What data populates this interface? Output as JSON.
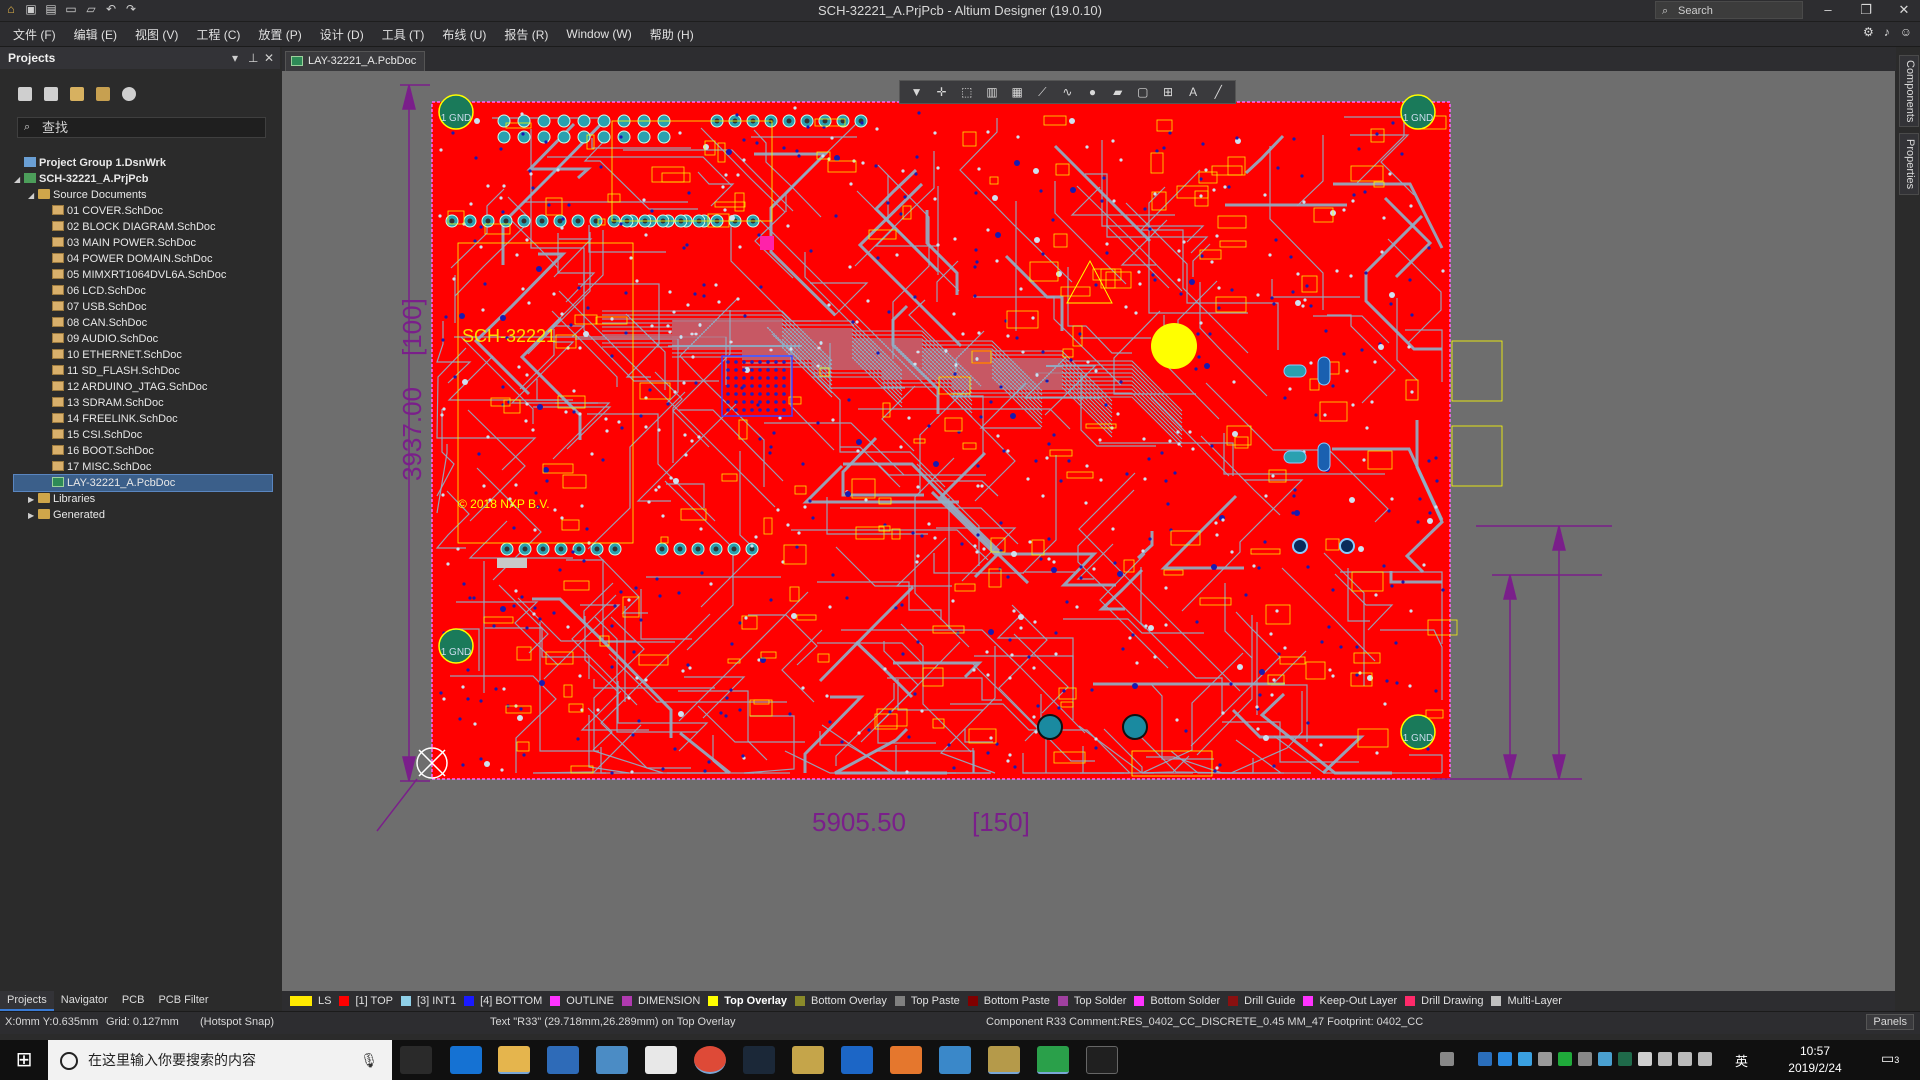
{
  "window": {
    "title": "SCH-32221_A.PrjPcb - Altium Designer (19.0.10)",
    "search_placeholder": "Search",
    "minimize": "–",
    "restore": "❐",
    "close": "✕"
  },
  "menu": [
    "文件 (F)",
    "编辑 (E)",
    "视图 (V)",
    "工程 (C)",
    "放置 (P)",
    "设计 (D)",
    "工具 (T)",
    "布线 (U)",
    "报告 (R)",
    "Window (W)",
    "帮助 (H)"
  ],
  "projects_panel": {
    "title": "Projects",
    "search_placeholder": "查找",
    "tree": [
      {
        "label": "Project Group 1.DsnWrk",
        "level": 0,
        "icon": "group",
        "bold": true,
        "arrow": ""
      },
      {
        "label": "SCH-32221_A.PrjPcb",
        "level": 0,
        "icon": "project",
        "bold": true,
        "arrow": "◢"
      },
      {
        "label": "Source Documents",
        "level": 1,
        "icon": "folder",
        "bold": false,
        "arrow": "◢"
      },
      {
        "label": "01 COVER.SchDoc",
        "level": 2,
        "icon": "doc"
      },
      {
        "label": "02 BLOCK DIAGRAM.SchDoc",
        "level": 2,
        "icon": "doc"
      },
      {
        "label": "03 MAIN POWER.SchDoc",
        "level": 2,
        "icon": "doc"
      },
      {
        "label": "04 POWER DOMAIN.SchDoc",
        "level": 2,
        "icon": "doc"
      },
      {
        "label": "05 MIMXRT1064DVL6A.SchDoc",
        "level": 2,
        "icon": "doc"
      },
      {
        "label": "06 LCD.SchDoc",
        "level": 2,
        "icon": "doc"
      },
      {
        "label": "07 USB.SchDoc",
        "level": 2,
        "icon": "doc"
      },
      {
        "label": "08 CAN.SchDoc",
        "level": 2,
        "icon": "doc"
      },
      {
        "label": "09 AUDIO.SchDoc",
        "level": 2,
        "icon": "doc"
      },
      {
        "label": "10 ETHERNET.SchDoc",
        "level": 2,
        "icon": "doc"
      },
      {
        "label": "11 SD_FLASH.SchDoc",
        "level": 2,
        "icon": "doc"
      },
      {
        "label": "12 ARDUINO_JTAG.SchDoc",
        "level": 2,
        "icon": "doc"
      },
      {
        "label": "13 SDRAM.SchDoc",
        "level": 2,
        "icon": "doc"
      },
      {
        "label": "14 FREELINK.SchDoc",
        "level": 2,
        "icon": "doc"
      },
      {
        "label": "15 CSI.SchDoc",
        "level": 2,
        "icon": "doc"
      },
      {
        "label": "16 BOOT.SchDoc",
        "level": 2,
        "icon": "doc"
      },
      {
        "label": "17 MISC.SchDoc",
        "level": 2,
        "icon": "doc"
      },
      {
        "label": "LAY-32221_A.PcbDoc",
        "level": 2,
        "icon": "pcb",
        "selected": true
      },
      {
        "label": "Libraries",
        "level": 1,
        "icon": "folder",
        "arrow": "▶"
      },
      {
        "label": "Generated",
        "level": 1,
        "icon": "folder",
        "arrow": "▶"
      }
    ],
    "tabs": [
      "Projects",
      "Navigator",
      "PCB",
      "PCB Filter"
    ]
  },
  "document_tab": "LAY-32221_A.PcbDoc",
  "right_tabs": [
    "Components",
    "Properties"
  ],
  "board": {
    "silk_texts": [
      "SCH-32221",
      "© 2018 NXP B.V.",
      "1 GND",
      "3937.00",
      "[100]",
      "5905.50",
      "[150]"
    ],
    "colors": {
      "board": "#ff0000",
      "track": "#8fb0c8",
      "overlay": "#ffff00",
      "dimension": "#7a1f8a",
      "canvas": "#6e6e6e"
    }
  },
  "layers": [
    {
      "name": "LS",
      "color": "#ffea00"
    },
    {
      "name": "[1] TOP",
      "color": "#ff0000"
    },
    {
      "name": "[3] INT1",
      "color": "#8fd0e8"
    },
    {
      "name": "[4] BOTTOM",
      "color": "#1a1aff"
    },
    {
      "name": "OUTLINE",
      "color": "#ff33ff"
    },
    {
      "name": "DIMENSION",
      "color": "#b03ab0"
    },
    {
      "name": "Top Overlay",
      "color": "#ffff00",
      "active": true
    },
    {
      "name": "Bottom Overlay",
      "color": "#8a8a2a"
    },
    {
      "name": "Top Paste",
      "color": "#808080"
    },
    {
      "name": "Bottom Paste",
      "color": "#800000"
    },
    {
      "name": "Top Solder",
      "color": "#a040a0"
    },
    {
      "name": "Bottom Solder",
      "color": "#ff33ff"
    },
    {
      "name": "Drill Guide",
      "color": "#8a1010"
    },
    {
      "name": "Keep-Out Layer",
      "color": "#ff33ff"
    },
    {
      "name": "Drill Drawing",
      "color": "#ff2a6a"
    },
    {
      "name": "Multi-Layer",
      "color": "#c0c0c0"
    }
  ],
  "status": {
    "coords": "X:0mm Y:0.635mm",
    "grid": "Grid: 0.127mm",
    "snap": "(Hotspot Snap)",
    "text_info": "Text \"R33\" (29.718mm,26.289mm) on Top Overlay",
    "component": "Component R33 Comment:RES_0402_CC_DISCRETE_0.45 MM_47 Footprint: 0402_CC",
    "panels": "Panels"
  },
  "taskbar": {
    "search_placeholder": "在这里输入你要搜索的内容",
    "time": "10:57",
    "date": "2019/2/24",
    "ime": "英",
    "notification_count": "3"
  }
}
